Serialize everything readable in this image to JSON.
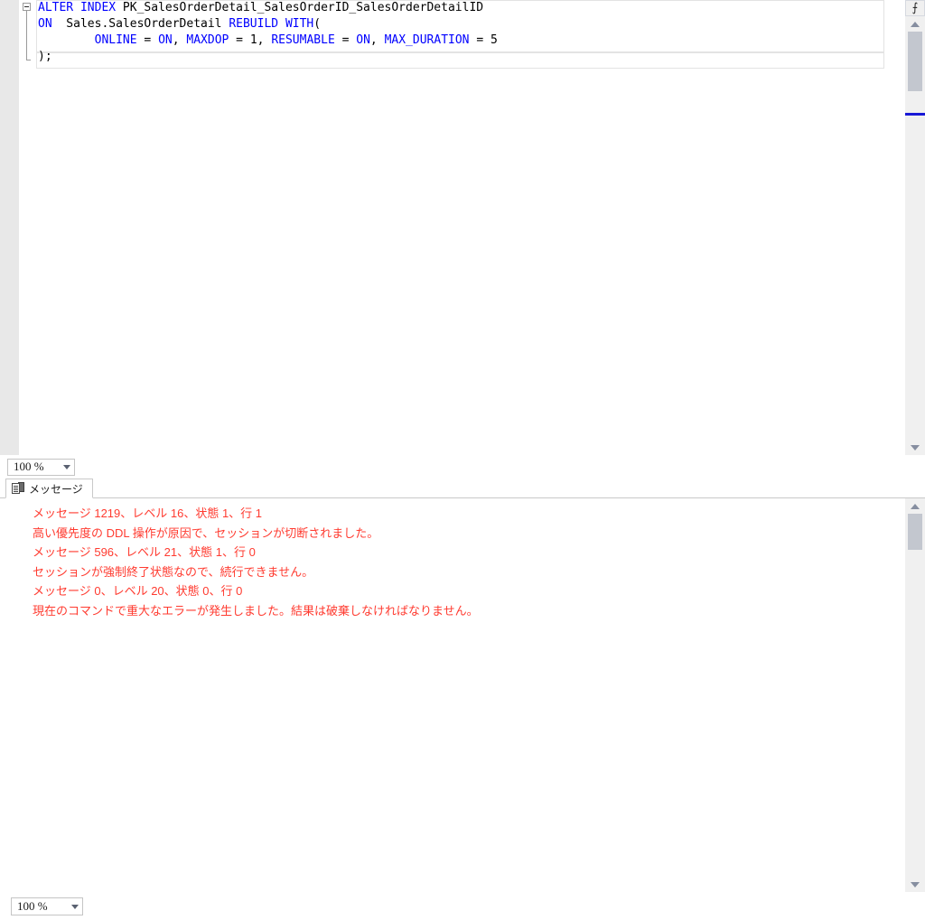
{
  "editor": {
    "name": "sql-query-editor",
    "fold_state": "expanded",
    "code_lines": [
      {
        "tokens": [
          {
            "text": "ALTER",
            "type": "keyword"
          },
          {
            "text": " ",
            "type": "plain"
          },
          {
            "text": "INDEX",
            "type": "keyword"
          },
          {
            "text": " PK_SalesOrderDetail_SalesOrderID_SalesOrderDetailID",
            "type": "identifier"
          }
        ]
      },
      {
        "tokens": [
          {
            "text": "ON",
            "type": "keyword"
          },
          {
            "text": "  Sales.SalesOrderDetail ",
            "type": "identifier"
          },
          {
            "text": "REBUILD",
            "type": "keyword"
          },
          {
            "text": " ",
            "type": "plain"
          },
          {
            "text": "WITH",
            "type": "keyword"
          },
          {
            "text": "(",
            "type": "plain"
          }
        ]
      },
      {
        "tokens": [
          {
            "text": "        ",
            "type": "plain"
          },
          {
            "text": "ONLINE",
            "type": "keyword"
          },
          {
            "text": " = ",
            "type": "plain"
          },
          {
            "text": "ON",
            "type": "keyword"
          },
          {
            "text": ", ",
            "type": "plain"
          },
          {
            "text": "MAXDOP",
            "type": "keyword"
          },
          {
            "text": " = ",
            "type": "plain"
          },
          {
            "text": "1",
            "type": "number"
          },
          {
            "text": ", ",
            "type": "plain"
          },
          {
            "text": "RESUMABLE",
            "type": "keyword"
          },
          {
            "text": " = ",
            "type": "plain"
          },
          {
            "text": "ON",
            "type": "keyword"
          },
          {
            "text": ", ",
            "type": "plain"
          },
          {
            "text": "MAX_DURATION",
            "type": "keyword"
          },
          {
            "text": " = ",
            "type": "plain"
          },
          {
            "text": "5",
            "type": "number"
          }
        ]
      },
      {
        "tokens": [
          {
            "text": ");",
            "type": "plain"
          }
        ]
      }
    ],
    "zoom": {
      "value": "100 %",
      "caret": "chevron-down-icon"
    },
    "scrollbar": {
      "up_arrow": "scroll-up-icon",
      "down_arrow": "scroll-down-icon",
      "splitter": "split-horizontal-icon",
      "splitter_glyph": "⨍"
    }
  },
  "results": {
    "tabs": [
      {
        "label": "メッセージ",
        "icon": "messages-icon",
        "active": true
      }
    ],
    "messages": [
      "メッセージ 1219、レベル 16、状態 1、行 1",
      "高い優先度の DDL 操作が原因で、セッションが切断されました。",
      "メッセージ 596、レベル 21、状態 1、行 0",
      "セッションが強制終了状態なので、続行できません。",
      "メッセージ 0、レベル 20、状態 0、行 0",
      "現在のコマンドで重大なエラーが発生しました。結果は破棄しなければなりません。"
    ],
    "zoom": {
      "value": "100 %",
      "caret": "chevron-down-icon"
    },
    "scrollbar": {
      "up_arrow": "scroll-up-icon",
      "down_arrow": "scroll-down-icon"
    }
  },
  "colors": {
    "keyword": "#0000ff",
    "identifier": "#000000",
    "error_text": "#ff3b30",
    "scroll_marker": "#1919d6",
    "scroll_thumb": "#c3c7cf",
    "scroll_track": "#f0f0f0",
    "gutter": "#e8e8e8"
  }
}
